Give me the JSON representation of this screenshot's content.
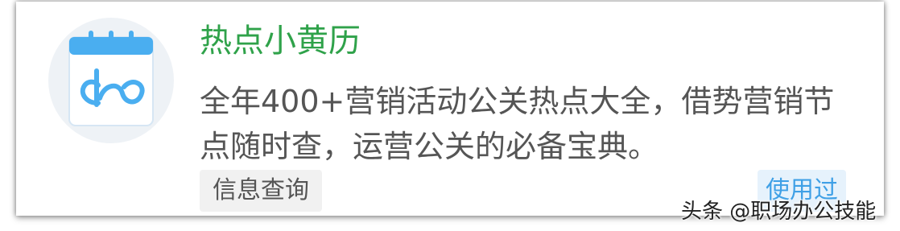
{
  "app": {
    "name": "热点小黄历",
    "description": "全年400+营销活动公关热点大全，借势营销节点随时查，运营公关的必备宝典。",
    "icon": "calendar-logo-icon",
    "tag": "信息查询",
    "status": "使用过"
  },
  "watermark": "头条 @职场办公技能",
  "colors": {
    "title": "#2fa24a",
    "status": "#3fa0e6",
    "icon_blue": "#4aaef0"
  }
}
